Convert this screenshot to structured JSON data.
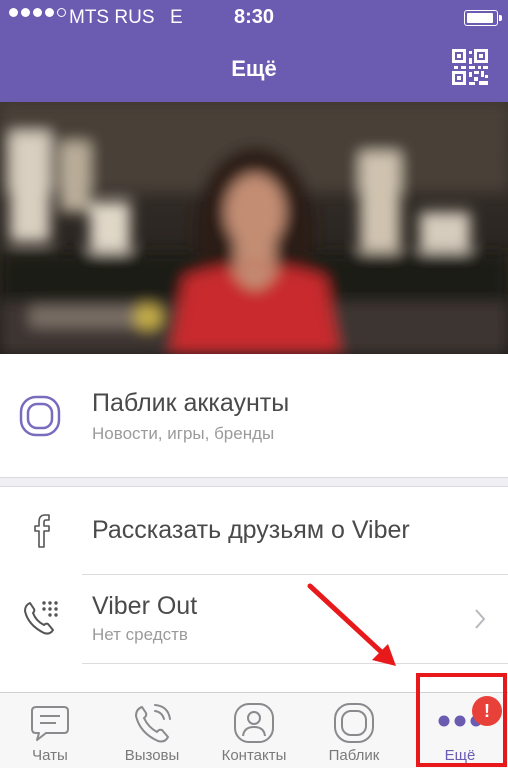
{
  "status_bar": {
    "carrier": "MTS RUS",
    "network": "E",
    "time": "8:30",
    "signal_bars": 4,
    "signal_max": 5
  },
  "nav_bar": {
    "title": "Ещё",
    "right_icon": "qr-code-icon"
  },
  "banner": {
    "image": "blurred-photo-woman-red-dress"
  },
  "menu": {
    "public_accounts": {
      "label": "Паблик аккаунты",
      "sublabel": "Новости, игры, бренды",
      "icon": "public-accounts-icon"
    },
    "tell_friends": {
      "label": "Рассказать друзьям о Viber",
      "icon": "facebook-icon"
    },
    "viber_out": {
      "label": "Viber Out",
      "sublabel": "Нет средств",
      "icon": "phone-dialpad-icon"
    }
  },
  "tab_bar": {
    "tabs": [
      {
        "label": "Чаты",
        "icon": "chat-bubble-icon"
      },
      {
        "label": "Вызовы",
        "icon": "phone-icon"
      },
      {
        "label": "Контакты",
        "icon": "contact-icon"
      },
      {
        "label": "Паблик",
        "icon": "public-icon"
      },
      {
        "label": "Ещё",
        "icon": "more-dots-icon",
        "active": true,
        "badge": "!"
      }
    ]
  },
  "colors": {
    "brand": "#6b5bb1",
    "badge": "#e8413a",
    "annotation": "#e8191b"
  }
}
